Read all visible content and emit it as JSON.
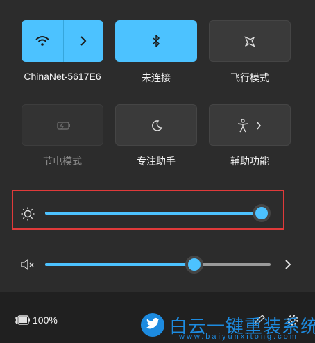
{
  "tiles": {
    "wifi_label": "ChinaNet-5617E6",
    "bluetooth_label": "未连接",
    "airplane_label": "飞行模式",
    "battery_saver_label": "节电模式",
    "focus_label": "专注助手",
    "accessibility_label": "辅助功能"
  },
  "brightness": {
    "level": 0.98
  },
  "volume": {
    "level": 0.66
  },
  "footer": {
    "battery_percent": "100%"
  },
  "watermark": {
    "text": "白云一键重装系统",
    "url": "www.baiyunxitong.com"
  },
  "colors": {
    "accent": "#4cc2ff",
    "panel": "#2c2c2c",
    "highlight": "#e03a3a"
  },
  "icons": [
    "wifi-icon",
    "bluetooth-icon",
    "airplane-icon",
    "battery-saver-icon",
    "moon-icon",
    "accessibility-icon",
    "brightness-icon",
    "mute-icon",
    "battery-icon",
    "pencil-icon",
    "gear-icon",
    "twitter-bird-icon"
  ]
}
